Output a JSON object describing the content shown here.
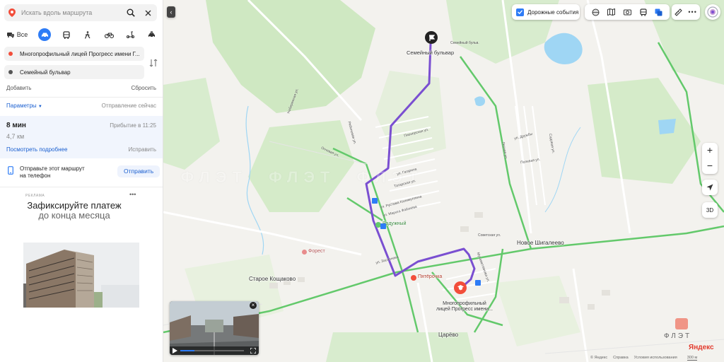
{
  "search": {
    "placeholder": "Искать вдоль маршрута"
  },
  "modes": {
    "all_label": "Все"
  },
  "route": {
    "from": "Многопрофильный лицей Прогресс имени Г...",
    "to": "Семейный бульвар",
    "add_label": "Добавить",
    "reset_label": "Сбросить",
    "params_label": "Параметры",
    "depart_label": "Отправление сейчас",
    "duration": "8 мин",
    "arrival": "Прибытие в 11:25",
    "distance": "4,7 км",
    "details_label": "Посмотреть подробнее",
    "fix_label": "Исправить"
  },
  "send": {
    "text": "Отправьте этот маршрут на телефон",
    "button": "Отправить"
  },
  "ad": {
    "label": "РЕКЛАМА",
    "more": "•••",
    "title_part1": "Зафиксируйте платеж",
    "title_part2": "до конца месяца"
  },
  "toolbar": {
    "traffic_label": "Дорожные события",
    "collapse": "‹"
  },
  "map": {
    "dest_label": "Семейный бульвар",
    "dest_small": "Семейный бульв.",
    "origin_label": "Многопрофильный лицей Прогресс имени...",
    "places": {
      "novoe": "Новое Шигалеево",
      "staroe": "Старое Кощаково",
      "tsarevo": "Царёво",
      "raduzhny": "Радужный",
      "forest": "Форест",
      "pyaterochka": "Пятёрочка",
      "sovetskaya": "Советская ул.",
      "druzhby": "ул. Дружбы",
      "polevaya": "Полевая ул.",
      "lesnaya": "Лесная ул.",
      "sadovaya": "Садовая ул.",
      "ozernaya": "Огневая ул.",
      "naberezhnaya": "Набережная ул.",
      "zaslamova": "ул. Заслонова",
      "pionerskaya": "Пионерская ул.",
      "mukhametzyanova": "Мухаметзянова ул.",
      "ryabinovaya": "Рябиновая ул.",
      "gagarina": "ул. Гагарина",
      "tatarskaya": "Татарская ул.",
      "kapilinskaya": "ул. Рустама Калимуллина",
      "marat": "ул. Марата Файзиева"
    },
    "watermark": "ФЛЭТ",
    "brand": "Яндекс",
    "footer": [
      "© Яндекс",
      "Справка",
      "Условия использования"
    ],
    "scale": "300 м",
    "controls": {
      "zoom_in": "+",
      "zoom_out": "−",
      "view3d": "3D"
    },
    "player": {
      "close": "×"
    }
  },
  "colors": {
    "accent": "#2e7cf6",
    "route": "#7a4fd1",
    "road": "#63c96b",
    "start": "#f24e3b",
    "water": "#6ec0f0"
  }
}
